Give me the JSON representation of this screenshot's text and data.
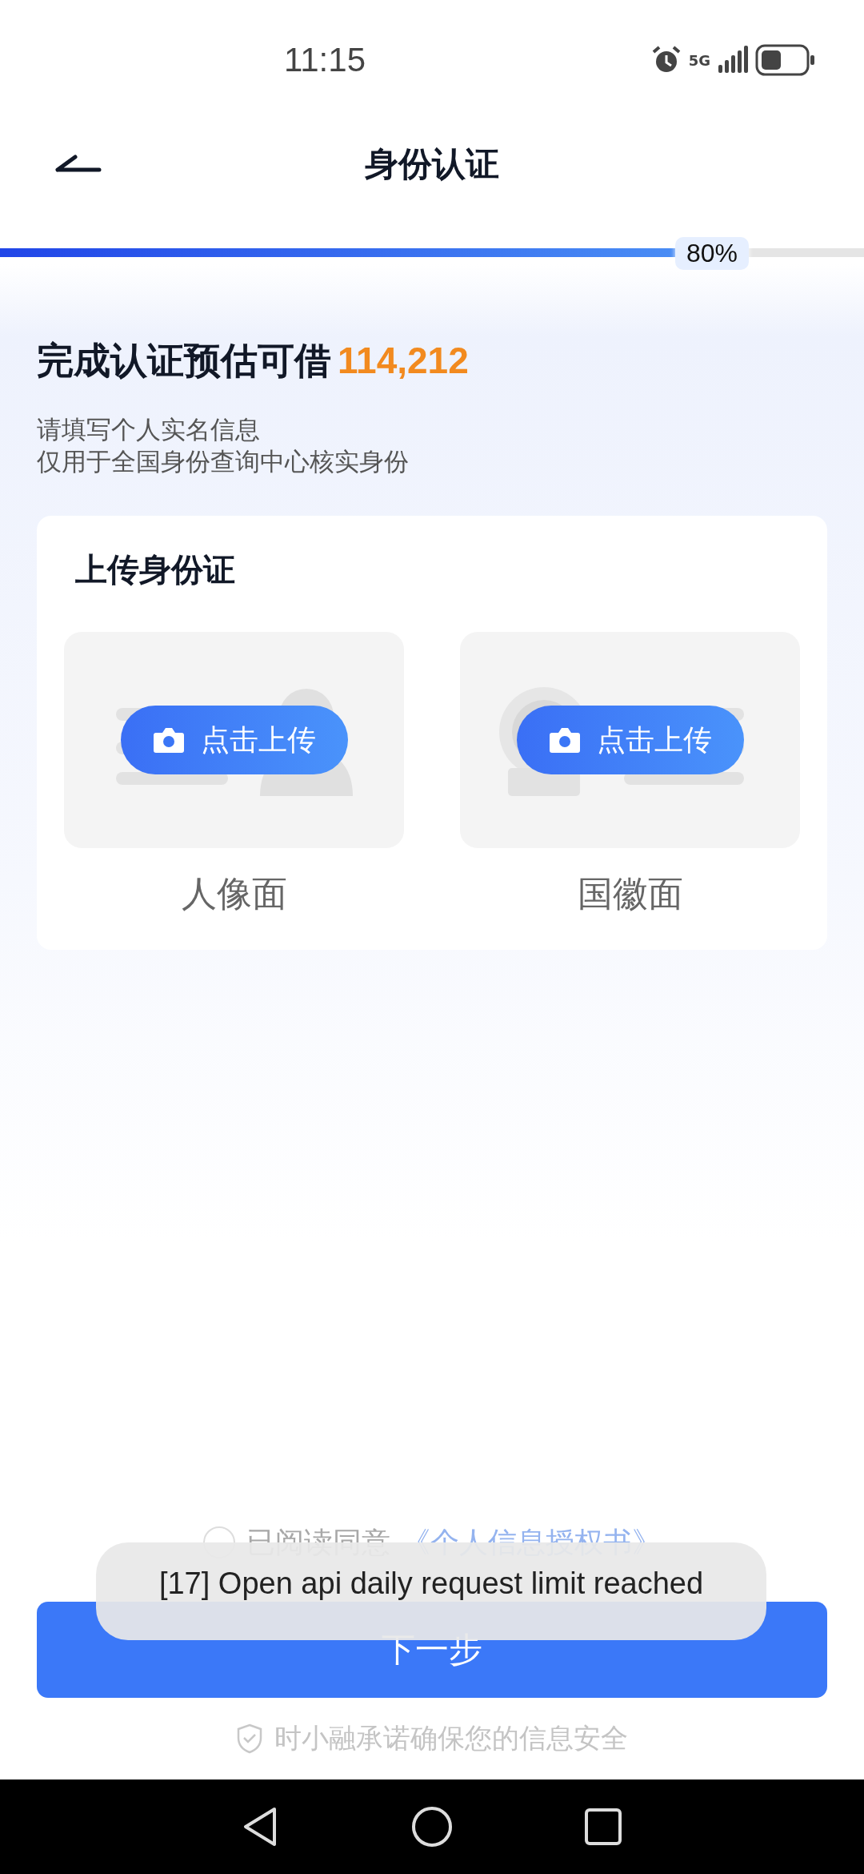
{
  "status_bar": {
    "time": "11:15",
    "network": "5G"
  },
  "header": {
    "title": "身份认证"
  },
  "progress": {
    "level": 0.8,
    "label": "80%"
  },
  "intro": {
    "heading": "完成认证预估可借",
    "amount": "114,212",
    "lines": [
      "请填写个人实名信息",
      "仅用于全国身份查询中心核实身份"
    ]
  },
  "upload_card": {
    "title": "上传身份证",
    "slots": [
      {
        "kind": "portrait",
        "button": "点击上传",
        "label": "人像面"
      },
      {
        "kind": "emblem",
        "button": "点击上传",
        "label": "国徽面"
      }
    ]
  },
  "agreement": {
    "checked": false,
    "text": "已阅读同意",
    "link": "《个人信息授权书》"
  },
  "next_button": "下一步",
  "footer": "时小融承诺确保您的信息安全",
  "toast": "[17] Open api daily request limit reached"
}
